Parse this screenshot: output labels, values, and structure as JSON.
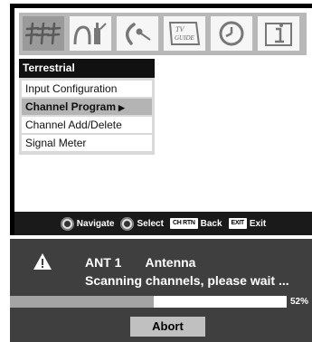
{
  "icons": [
    {
      "name": "antenna-icon",
      "active": true
    },
    {
      "name": "audio-icon"
    },
    {
      "name": "satellite-dish-icon"
    },
    {
      "name": "tv-guide-icon",
      "text": [
        "TV",
        "GUIDE"
      ]
    },
    {
      "name": "clock-icon"
    },
    {
      "name": "info-icon"
    }
  ],
  "menu": {
    "title": "Terrestrial",
    "items": [
      {
        "label": "Input Configuration"
      },
      {
        "label": "Channel Program",
        "selected": true,
        "arrow": "▶"
      },
      {
        "label": "Channel Add/Delete"
      },
      {
        "label": "Signal Meter"
      }
    ]
  },
  "navbar": {
    "navigate": "Navigate",
    "select": "Select",
    "back_key": "CH RTN",
    "back": "Back",
    "exit_key": "EXIT",
    "exit": "Exit"
  },
  "scan": {
    "antenna_id": "ANT 1",
    "antenna_type": "Antenna",
    "message": "Scanning channels, please wait ...",
    "progress_percent": 52,
    "progress_label": "52%",
    "abort_label": "Abort"
  }
}
